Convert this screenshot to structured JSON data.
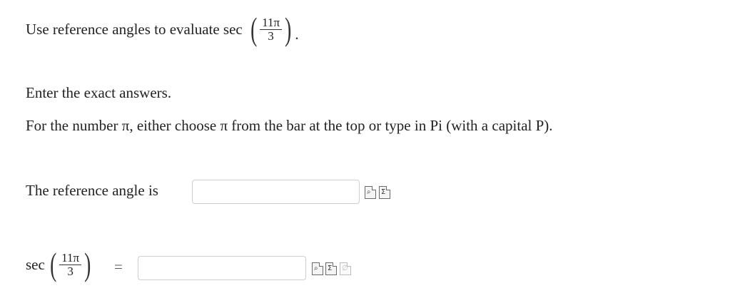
{
  "question": {
    "prompt": "Use reference angles to evaluate sec",
    "arg_numerator": "11π",
    "arg_denominator": "3",
    "period": "."
  },
  "instructions": {
    "exact": "Enter the exact answers.",
    "pi_hint": "For the number π, either choose π from the bar at the top or type in Pi (with a capital P)."
  },
  "reference_angle": {
    "label": "The reference angle is",
    "value": ""
  },
  "sec_answer": {
    "func": "sec",
    "arg_numerator": "11π",
    "arg_denominator": "3",
    "equals": "=",
    "value": ""
  },
  "icons": {
    "preview": "preview-icon",
    "equation_editor": "equation-editor-icon",
    "not_applicable": "not-applicable-icon"
  }
}
